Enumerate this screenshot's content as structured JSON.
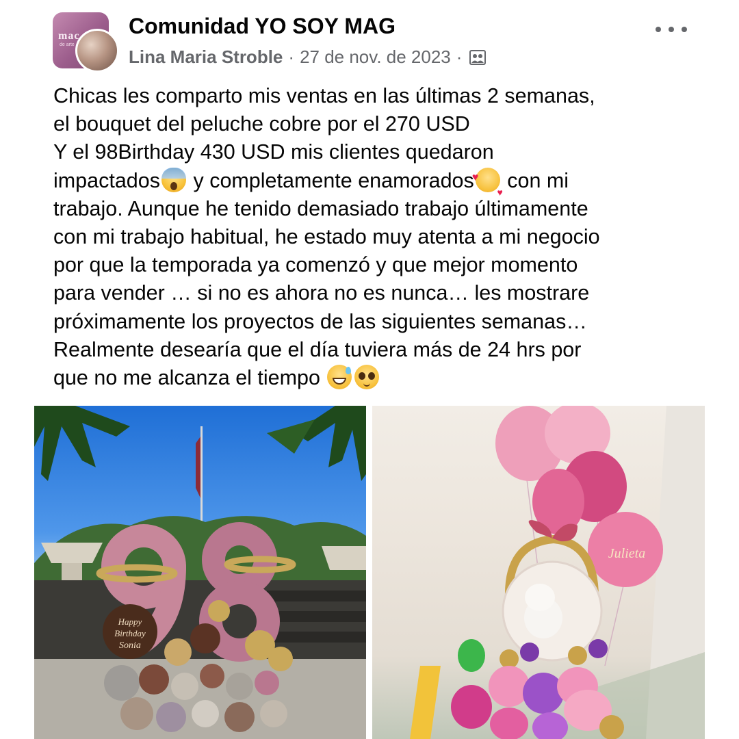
{
  "post": {
    "group_name": "Comunidad YO SOY MAG",
    "author": "Lina Maria Stroble",
    "separator": "·",
    "date": "27 de nov. de 2023",
    "audience_icon": "group-audience-icon",
    "more_icon": "more-horizontal-icon",
    "avatar_logo_text": "mac",
    "avatar_logo_sub": "de arte",
    "text_lines": [
      "Chicas les comparto mis  ventas en las últimas 2 semanas,",
      "el bouquet del peluche cobre por el 270 USD",
      "Y el 98Birthday 430 USD mis clientes quedaron",
      "y completamente enamorados",
      "con mi",
      "trabajo. Aunque he tenido demasiado trabajo últimamente",
      "con mi trabajo habitual, he estado muy atenta a mi negocio",
      "por que la temporada ya comenzó y que mejor momento",
      "para vender … si no es ahora no es nunca… les mostrare",
      "próximamente los proyectos de las siguientes semanas…",
      "Realmente desearía que el día tuviera más de 24 hrs por",
      "que no me alcanza el tiempo"
    ],
    "line4_start": "impactados",
    "emojis": [
      "face-screaming-in-fear",
      "smiling-face-with-hearts",
      "grinning-face-with-sweat",
      "pleading-face"
    ]
  },
  "photos": {
    "left": {
      "sign_line1": "Happy",
      "sign_line2": "Birthday",
      "sign_line3": "Sonia"
    },
    "right": {
      "balloon_text": "Julieta"
    }
  }
}
